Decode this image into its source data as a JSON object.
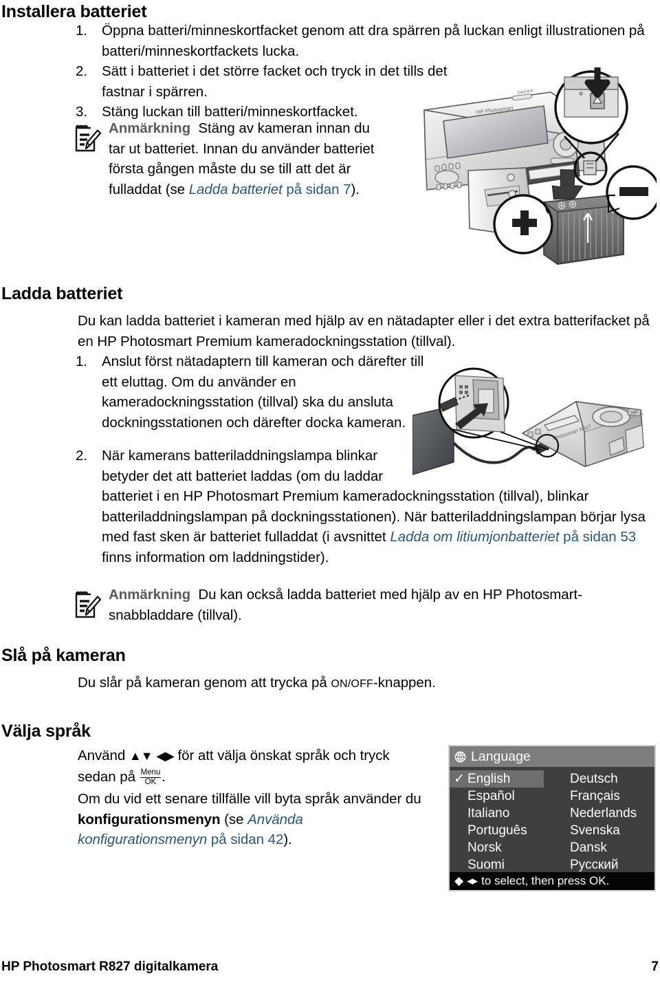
{
  "document": {
    "footer_left": "HP Photosmart R827 digitalkamera",
    "footer_page": "7"
  },
  "sections": {
    "install_battery": {
      "heading": "Installera batteriet",
      "steps": [
        {
          "num": "1.",
          "text": "Öppna batteri/minneskortfacket genom att dra spärren på luckan enligt illustrationen på batteri/minneskortfackets lucka."
        },
        {
          "num": "2.",
          "text": "Sätt i batteriet i det större facket och tryck in det tills det fastnar i spärren."
        },
        {
          "num": "3.",
          "text": "Stäng luckan till batteri/minneskortfacket."
        }
      ],
      "note": {
        "label": "Anmärkning",
        "text_1": "Stäng av kameran innan du tar ut batteriet. Innan du använder batteriet första gången måste du se till att det är fulladdat (se ",
        "link_italic": "Ladda batteriet",
        "link_plain": " på sidan 7",
        "text_2": ")."
      }
    },
    "charge_battery": {
      "heading": "Ladda batteriet",
      "intro": "Du kan ladda batteriet i kameran med hjälp av en nätadapter eller i det extra batterifacket på en HP Photosmart Premium kameradockningsstation (tillval).",
      "steps": [
        {
          "num": "1.",
          "text": "Anslut först nätadaptern till kameran och därefter till ett eluttag. Om du använder en kameradockningsstation (tillval) ska du ansluta dockningsstationen och därefter docka kameran."
        },
        {
          "num": "2.",
          "text_1": "När kamerans batteriladdningslampa blinkar betyder det att batteriet laddas (om du laddar batteriet i en HP Photosmart Premium kameradockningsstation (tillval), blinkar batteriladdningslampan på dockningsstationen). När batteriladdningslampan börjar lysa med fast sken är batteriet fulladdat (i avsnittet ",
          "link_italic": "Ladda om litiumjonbatteriet",
          "link_plain": " på sidan 53",
          "text_2": " finns information om laddningstider)."
        }
      ],
      "note": {
        "label": "Anmärkning",
        "text": "Du kan också ladda batteriet med hjälp av en HP Photosmart-snabbladdare (tillval)."
      }
    },
    "turn_on_camera": {
      "heading": "Slå på kameran",
      "text_1": "Du slår på kameran genom att trycka på ",
      "onoff_label": "ON/OFF",
      "text_2": "-knappen."
    },
    "choose_language": {
      "heading": "Välja språk",
      "p1_a": "Använd ",
      "p1_b": " för att välja önskat språk och tryck sedan på ",
      "menu_top": "Menu",
      "menu_bottom": "OK",
      "p1_c": ".",
      "p2_a": "Om du vid ett senare tillfälle vill byta språk använder du ",
      "p2_bold": "konfigurationsmenyn",
      "p2_b": " (se ",
      "link_italic": "Använda konfigurationsmenyn",
      "link_plain": " på sidan 42",
      "p2_c": ")."
    }
  },
  "language_screen": {
    "title": "Language",
    "items": [
      {
        "label": "English",
        "selected": true
      },
      {
        "label": "Deutsch",
        "selected": false
      },
      {
        "label": "Español",
        "selected": false
      },
      {
        "label": "Français",
        "selected": false
      },
      {
        "label": "Italiano",
        "selected": false
      },
      {
        "label": "Nederlands",
        "selected": false
      },
      {
        "label": "Português",
        "selected": false
      },
      {
        "label": "Svenska",
        "selected": false
      },
      {
        "label": "Norsk",
        "selected": false
      },
      {
        "label": "Dansk",
        "selected": false
      },
      {
        "label": "Suomi",
        "selected": false
      },
      {
        "label": "Русский",
        "selected": false
      }
    ],
    "footer_hint": "to select, then press OK.",
    "colors": {
      "title_bar": "#7d7d7d",
      "body": "#3f3f3f",
      "selected_row": "#6e6e6e",
      "footer_bar": "#050505",
      "border": "#cfcfcf"
    }
  },
  "illustrations": {
    "battery_install": {
      "caption_brand": "HP Photosmart",
      "onoff_label": "ON/OFF",
      "plus_label": "+",
      "minus_label": "–"
    },
    "ac_adapter": {
      "caption_brand": "Photosmart R827"
    }
  },
  "theme": {
    "link_color": "#28567e",
    "note_label_color": "#5a5a5a",
    "text_color": "#000000",
    "page_background": "#ffffff"
  }
}
